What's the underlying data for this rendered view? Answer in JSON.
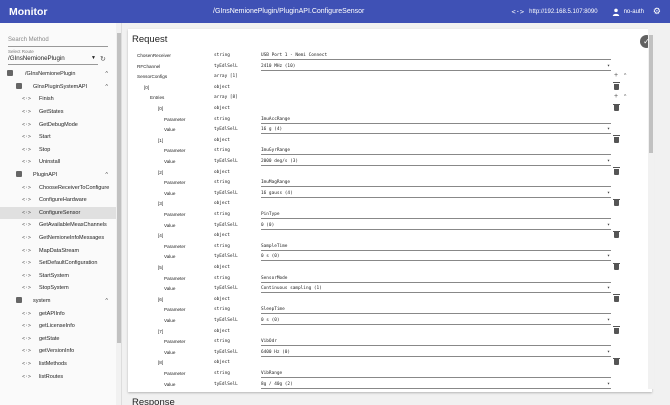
{
  "app": {
    "title": "Monitor",
    "path": "/GInsNemionePlugin/PluginAPI.ConfigureSensor",
    "code_icon": "<·>",
    "url": "http://192.168.5.107:8090",
    "auth": "no-auth",
    "gear_icon": "⚙"
  },
  "sidebar": {
    "search_placeholder": "Search Method",
    "route_label": "Select Route",
    "route_value": "/GInsNemionePlugin",
    "refresh_icon": "↻",
    "tree": [
      {
        "label": "/GInsNemionePlugin",
        "kind": "root",
        "chev": "^"
      },
      {
        "label": "GInsPluginSystemAPI",
        "kind": "group",
        "chev": "^"
      },
      {
        "label": "Finish",
        "kind": "method"
      },
      {
        "label": "GetStates",
        "kind": "method"
      },
      {
        "label": "GetDebugMode",
        "kind": "method"
      },
      {
        "label": "Start",
        "kind": "method"
      },
      {
        "label": "Stop",
        "kind": "method"
      },
      {
        "label": "Uninstall",
        "kind": "method"
      },
      {
        "label": "PluginAPI",
        "kind": "group",
        "chev": "^"
      },
      {
        "label": "ChooseReceiverToConfigure",
        "kind": "method"
      },
      {
        "label": "ConfigureHardware",
        "kind": "method"
      },
      {
        "label": "ConfigureSensor",
        "kind": "method",
        "selected": true
      },
      {
        "label": "GetAvailableMeasChannels",
        "kind": "method"
      },
      {
        "label": "GetNemioneInfoMessages",
        "kind": "method"
      },
      {
        "label": "MapDataStream",
        "kind": "method"
      },
      {
        "label": "SetDefaultConfiguration",
        "kind": "method"
      },
      {
        "label": "StartSystem",
        "kind": "method"
      },
      {
        "label": "StopSystem",
        "kind": "method"
      },
      {
        "label": "system",
        "kind": "group",
        "chev": "^"
      },
      {
        "label": "getAPIInfo",
        "kind": "method"
      },
      {
        "label": "getLicenseInfo",
        "kind": "method"
      },
      {
        "label": "getState",
        "kind": "method"
      },
      {
        "label": "getVersionInfo",
        "kind": "method"
      },
      {
        "label": "listMethods",
        "kind": "method"
      },
      {
        "label": "listRoutes",
        "kind": "method"
      }
    ]
  },
  "request": {
    "title": "Request",
    "submit_icon": "✓",
    "rows": [
      {
        "name": "ChosenReceiver",
        "indent": 0,
        "type": "string",
        "value": "USB Port 1 - Nemi Connect",
        "field": "text"
      },
      {
        "name": "RFChannel",
        "indent": 0,
        "type": "tyEdlSelL",
        "value": "2410 MHz (10)",
        "field": "select"
      },
      {
        "name": "SensorConfigs",
        "indent": 0,
        "type": "array [1]",
        "value": "",
        "field": "none",
        "actions": "add-collapse"
      },
      {
        "name": "[0]",
        "indent": 1,
        "type": "object",
        "value": "",
        "field": "none",
        "actions": "delete"
      },
      {
        "name": "Entries",
        "indent": 2,
        "type": "array [8]",
        "value": "",
        "field": "none",
        "actions": "add-collapse"
      },
      {
        "name": "[0]",
        "indent": 3,
        "type": "object",
        "value": "",
        "field": "none",
        "actions": "delete"
      },
      {
        "name": "Parameter",
        "indent": 4,
        "type": "string",
        "value": "ImuAccRange",
        "field": "text"
      },
      {
        "name": "Value",
        "indent": 4,
        "type": "tyEdlSelL",
        "value": "16 g (4)",
        "field": "select"
      },
      {
        "name": "[1]",
        "indent": 3,
        "type": "object",
        "value": "",
        "field": "none",
        "actions": "delete"
      },
      {
        "name": "Parameter",
        "indent": 4,
        "type": "string",
        "value": "ImuGyrRange",
        "field": "text"
      },
      {
        "name": "Value",
        "indent": 4,
        "type": "tyEdlSelL",
        "value": "2000 deg/s (3)",
        "field": "select"
      },
      {
        "name": "[2]",
        "indent": 3,
        "type": "object",
        "value": "",
        "field": "none",
        "actions": "delete"
      },
      {
        "name": "Parameter",
        "indent": 4,
        "type": "string",
        "value": "ImuMagRange",
        "field": "text"
      },
      {
        "name": "Value",
        "indent": 4,
        "type": "tyEdlSelL",
        "value": "16 gauss (4)",
        "field": "select"
      },
      {
        "name": "[3]",
        "indent": 3,
        "type": "object",
        "value": "",
        "field": "none",
        "actions": "delete"
      },
      {
        "name": "Parameter",
        "indent": 4,
        "type": "string",
        "value": "PinType",
        "field": "text"
      },
      {
        "name": "Value",
        "indent": 4,
        "type": "tyEdlSelL",
        "value": "0 (0)",
        "field": "select"
      },
      {
        "name": "[4]",
        "indent": 3,
        "type": "object",
        "value": "",
        "field": "none",
        "actions": "delete"
      },
      {
        "name": "Parameter",
        "indent": 4,
        "type": "string",
        "value": "SampleTime",
        "field": "text"
      },
      {
        "name": "Value",
        "indent": 4,
        "type": "tyEdlSelL",
        "value": "0 s (0)",
        "field": "select"
      },
      {
        "name": "[5]",
        "indent": 3,
        "type": "object",
        "value": "",
        "field": "none",
        "actions": "delete"
      },
      {
        "name": "Parameter",
        "indent": 4,
        "type": "string",
        "value": "SensorMode",
        "field": "text"
      },
      {
        "name": "Value",
        "indent": 4,
        "type": "tyEdlSelL",
        "value": "Continuous sampling (1)",
        "field": "select"
      },
      {
        "name": "[6]",
        "indent": 3,
        "type": "object",
        "value": "",
        "field": "none",
        "actions": "delete"
      },
      {
        "name": "Parameter",
        "indent": 4,
        "type": "string",
        "value": "SleepTime",
        "field": "text"
      },
      {
        "name": "Value",
        "indent": 4,
        "type": "tyEdlSelL",
        "value": "0 s (0)",
        "field": "select"
      },
      {
        "name": "[7]",
        "indent": 3,
        "type": "object",
        "value": "",
        "field": "none",
        "actions": "delete"
      },
      {
        "name": "Parameter",
        "indent": 4,
        "type": "string",
        "value": "VibOdr",
        "field": "text"
      },
      {
        "name": "Value",
        "indent": 4,
        "type": "tyEdlSelL",
        "value": "6400 Hz (0)",
        "field": "select"
      },
      {
        "name": "[8]",
        "indent": 3,
        "type": "object",
        "value": "",
        "field": "none",
        "actions": "delete"
      },
      {
        "name": "Parameter",
        "indent": 4,
        "type": "string",
        "value": "VibRange",
        "field": "text"
      },
      {
        "name": "Value",
        "indent": 4,
        "type": "tyEdlSelL",
        "value": "8g / 40g (2)",
        "field": "select"
      }
    ]
  },
  "response": {
    "title": "Response"
  }
}
